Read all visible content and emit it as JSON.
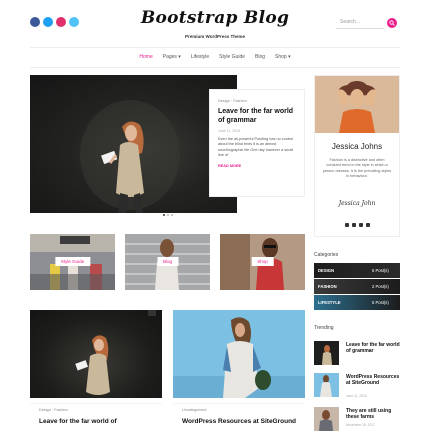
{
  "header": {
    "title": "Bootstrap Blog",
    "tagline": "Premium WordPress Theme",
    "search_placeholder": "Search...",
    "social": [
      {
        "icon": "facebook-icon",
        "color": "#3b5998"
      },
      {
        "icon": "twitter-icon",
        "color": "#1da1f2"
      },
      {
        "icon": "instagram-icon",
        "color": "#e1306c"
      },
      {
        "icon": "email-icon",
        "color": "#4fc3f7"
      }
    ],
    "accent": "#e91e8c"
  },
  "nav": {
    "items": [
      "Home",
      "Pages ▾",
      "Lifestyle",
      "Style Guide",
      "Blog",
      "Shop ▾"
    ]
  },
  "feature": {
    "category": "Design · Fashion",
    "title": "Leave for the far world of grammar",
    "date": "June 11, 2018",
    "excerpt": "Even the all-powerful Pointing has no control about the blind texts it is an almost unorthographic life One day however a small line of",
    "read_more": "READ MORE"
  },
  "thumbs": [
    {
      "label": "Style Guide"
    },
    {
      "label": "Blog"
    },
    {
      "label": "Shop"
    }
  ],
  "posts": [
    {
      "category": "Design · Fashion",
      "title": "Leave for the far world of"
    },
    {
      "category": "Uncategorized",
      "title": "WordPress Resources at SiteGround"
    }
  ],
  "sidebar": {
    "about": {
      "name": "Jessica Johns",
      "text": "Fashion is a distinctive and often constant trend in the style in which a person dresses. It is the prevailing styles in behaviour.",
      "signature": "Jessica John"
    },
    "categories_title": "Categories",
    "categories": [
      {
        "name": "DESIGN",
        "count": "5 Post(s)"
      },
      {
        "name": "FASHION",
        "count": "2 Post(s)"
      },
      {
        "name": "LIFESTYLE",
        "count": "5 Post(s)"
      }
    ],
    "trending_title": "Trending",
    "trending": [
      {
        "title": "Leave for the far world of grammar",
        "date": ""
      },
      {
        "title": "WordPress Resources at SiteGround",
        "date": "June 11, 2018"
      },
      {
        "title": "They are still using these farms",
        "date": "November 15, 2017"
      }
    ]
  }
}
